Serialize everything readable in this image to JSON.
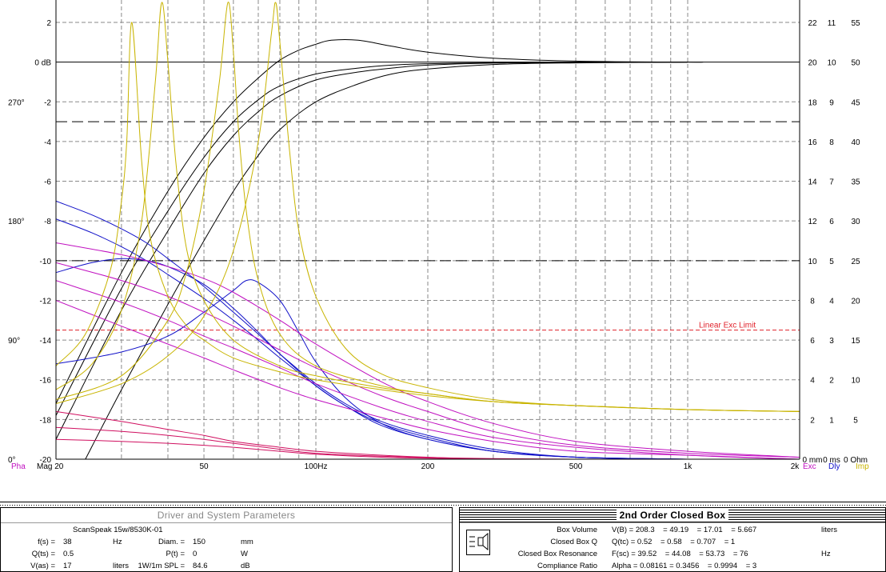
{
  "chart_data": {
    "type": "line",
    "x_scale": "log",
    "xlim": [
      20,
      2000
    ],
    "x_ticks": [
      {
        "v": 20,
        "t": "Mag 20"
      },
      {
        "v": 50,
        "t": "50"
      },
      {
        "v": 100,
        "t": "100Hz"
      },
      {
        "v": 200,
        "t": "200"
      },
      {
        "v": 500,
        "t": "500"
      },
      {
        "v": 1000,
        "t": "1k"
      },
      {
        "v": 2000,
        "t": "2k"
      }
    ],
    "mag_axis": {
      "label": "dB",
      "ylim": [
        -20,
        3
      ],
      "ticks": [
        {
          "v": 2,
          "t": "2"
        },
        {
          "v": 0,
          "t": "0 dB"
        },
        {
          "v": -2,
          "t": "-2"
        },
        {
          "v": -4,
          "t": "-4"
        },
        {
          "v": -6,
          "t": "-6"
        },
        {
          "v": -8,
          "t": "-8"
        },
        {
          "v": -10,
          "t": "-10"
        },
        {
          "v": -12,
          "t": "-12"
        },
        {
          "v": -14,
          "t": "-14"
        },
        {
          "v": -16,
          "t": "-16"
        },
        {
          "v": -18,
          "t": "-18"
        },
        {
          "v": -20,
          "t": "-20"
        }
      ]
    },
    "phase_axis": {
      "label": "Pha",
      "ticks": [
        {
          "v": -2,
          "t": "270°"
        },
        {
          "v": -8,
          "t": "180°"
        },
        {
          "v": -14,
          "t": "90°"
        },
        {
          "v": -20,
          "t": "0°"
        }
      ]
    },
    "exc_axis": {
      "label": "Exc",
      "ticks": [
        "22",
        "20",
        "18",
        "16",
        "14",
        "12",
        "10",
        "8",
        "6",
        "4",
        "2",
        "0 mm"
      ]
    },
    "dly_axis": {
      "label": "Dly",
      "ticks": [
        "11",
        "10",
        "9",
        "8",
        "7",
        "6",
        "5",
        "4",
        "3",
        "2",
        "1",
        "0 ms"
      ]
    },
    "imp_axis": {
      "label": "Imp",
      "ticks": [
        "55",
        "50",
        "45",
        "40",
        "35",
        "30",
        "25",
        "20",
        "15",
        "10",
        "5",
        "0 Ohm"
      ]
    },
    "reference_lines": [
      {
        "y": 0,
        "style": "solid"
      },
      {
        "y": -3,
        "style": "dashed"
      },
      {
        "y": -10,
        "style": "dashed"
      }
    ],
    "limit_line": {
      "y": -13.5,
      "label": "Linear Exc Limit",
      "color": "#e0202a"
    },
    "colors": {
      "magnitude": "#000000",
      "excursion": "#1010c8",
      "delay": "#c010c0",
      "impedance": "#c8b400",
      "phase": "#d01060",
      "grid": "#8a8a8a",
      "limit": "#e0202a"
    },
    "series": [
      {
        "group": "magnitude",
        "x": [
          20,
          30,
          40,
          50,
          60,
          70,
          80,
          90,
          100,
          110,
          130,
          160,
          200,
          300,
          500,
          1000,
          1100
        ],
        "y": [
          -17.2,
          -10.6,
          -6.5,
          -3.8,
          -2.0,
          -0.8,
          0.1,
          0.6,
          0.9,
          1.1,
          1.1,
          0.8,
          0.5,
          0.2,
          0.05,
          0.0,
          0.0
        ]
      },
      {
        "group": "magnitude",
        "x": [
          20,
          30,
          40,
          50,
          60,
          70,
          80,
          100,
          130,
          160,
          200,
          300,
          500,
          1000
        ],
        "y": [
          -17.8,
          -11.4,
          -7.5,
          -4.8,
          -3.0,
          -1.9,
          -1.2,
          -0.6,
          -0.3,
          -0.15,
          -0.08,
          -0.03,
          -0.01,
          0.0
        ]
      },
      {
        "group": "magnitude",
        "x": [
          20,
          30,
          40,
          50,
          60,
          70,
          80,
          100,
          130,
          160,
          200,
          300,
          500,
          1000
        ],
        "y": [
          -19.0,
          -12.5,
          -8.5,
          -5.6,
          -3.7,
          -2.5,
          -1.7,
          -0.9,
          -0.5,
          -0.3,
          -0.15,
          -0.05,
          -0.02,
          0.0
        ]
      },
      {
        "group": "magnitude",
        "x": [
          24,
          30,
          40,
          50,
          60,
          70,
          80,
          100,
          130,
          160,
          200,
          300,
          500,
          1000
        ],
        "y": [
          -20,
          -16.5,
          -12.2,
          -9.0,
          -6.5,
          -4.7,
          -3.4,
          -2.0,
          -1.1,
          -0.6,
          -0.35,
          -0.12,
          -0.04,
          0.0
        ]
      },
      {
        "group": "excursion",
        "x": [
          20,
          25,
          30,
          35,
          40,
          50,
          60,
          70,
          80,
          100,
          120,
          150,
          200,
          300,
          500,
          1000
        ],
        "y": [
          -10.6,
          -10.1,
          -9.9,
          -10.0,
          -10.3,
          -11.2,
          -12.4,
          -13.6,
          -14.7,
          -16.3,
          -17.3,
          -18.3,
          -19.0,
          -19.6,
          -19.9,
          -20.0
        ]
      },
      {
        "group": "excursion",
        "x": [
          20,
          25,
          30,
          35,
          40,
          50,
          60,
          70,
          80,
          100,
          120,
          150,
          200,
          300,
          500,
          1000
        ],
        "y": [
          -7.9,
          -8.6,
          -9.3,
          -10.0,
          -10.7,
          -11.9,
          -13.0,
          -14.0,
          -14.9,
          -16.3,
          -17.3,
          -18.2,
          -18.9,
          -19.6,
          -19.9,
          -20.0
        ]
      },
      {
        "group": "excursion",
        "x": [
          20,
          25,
          30,
          35,
          40,
          50,
          60,
          70,
          80,
          100,
          120,
          150,
          200,
          300,
          500,
          1000
        ],
        "y": [
          -7.0,
          -7.7,
          -8.4,
          -9.1,
          -9.9,
          -11.3,
          -12.6,
          -13.7,
          -14.7,
          -16.2,
          -17.2,
          -18.1,
          -18.8,
          -19.5,
          -19.9,
          -20.0
        ]
      },
      {
        "group": "excursion",
        "x": [
          20,
          30,
          40,
          50,
          60,
          65,
          70,
          80,
          90,
          100,
          120,
          150,
          200,
          300,
          500,
          1000
        ],
        "y": [
          -15.2,
          -14.6,
          -13.8,
          -12.6,
          -11.5,
          -11.0,
          -11.1,
          -12.0,
          -13.6,
          -15.1,
          -16.9,
          -18.2,
          -19.0,
          -19.6,
          -19.9,
          -20.0
        ]
      },
      {
        "group": "delay",
        "x": [
          20,
          30,
          40,
          50,
          60,
          80,
          100,
          150,
          200,
          300,
          500,
          1000,
          2000
        ],
        "y": [
          -9.1,
          -9.7,
          -10.3,
          -10.9,
          -11.6,
          -13.0,
          -14.2,
          -16.1,
          -17.1,
          -18.2,
          -19.1,
          -19.6,
          -19.9
        ]
      },
      {
        "group": "delay",
        "x": [
          20,
          30,
          40,
          50,
          60,
          80,
          100,
          150,
          200,
          300,
          500,
          1000,
          2000
        ],
        "y": [
          -10.1,
          -11.0,
          -11.8,
          -12.6,
          -13.3,
          -14.5,
          -15.4,
          -16.8,
          -17.6,
          -18.6,
          -19.3,
          -19.7,
          -19.9
        ]
      },
      {
        "group": "delay",
        "x": [
          20,
          30,
          40,
          50,
          60,
          80,
          100,
          150,
          200,
          300,
          500,
          1000,
          2000
        ],
        "y": [
          -11.0,
          -12.1,
          -13.0,
          -13.8,
          -14.4,
          -15.4,
          -16.2,
          -17.4,
          -18.1,
          -18.9,
          -19.4,
          -19.8,
          -20.0
        ]
      },
      {
        "group": "delay",
        "x": [
          20,
          30,
          40,
          50,
          60,
          80,
          100,
          150,
          200,
          300,
          500,
          1000,
          2000
        ],
        "y": [
          -12.0,
          -13.3,
          -14.2,
          -14.9,
          -15.5,
          -16.4,
          -17.0,
          -17.9,
          -18.5,
          -19.1,
          -19.6,
          -19.8,
          -20.0
        ]
      },
      {
        "group": "phase",
        "x": [
          20,
          30,
          40,
          50,
          60,
          80,
          100,
          150,
          200,
          300,
          500,
          1000,
          2000
        ],
        "y": [
          -17.6,
          -18.1,
          -18.5,
          -18.8,
          -19.1,
          -19.4,
          -19.6,
          -19.8,
          -19.9,
          -20.0,
          -20.0,
          -20.0,
          -20.0
        ]
      },
      {
        "group": "phase",
        "x": [
          20,
          30,
          40,
          50,
          60,
          80,
          100,
          150,
          200,
          300,
          500,
          1000,
          2000
        ],
        "y": [
          -18.4,
          -18.6,
          -18.8,
          -19.0,
          -19.2,
          -19.5,
          -19.7,
          -19.85,
          -19.92,
          -19.97,
          -20.0,
          -20.0,
          -20.0
        ]
      },
      {
        "group": "phase",
        "x": [
          20,
          30,
          40,
          50,
          60,
          80,
          100,
          150,
          200,
          300,
          500,
          1000,
          2000
        ],
        "y": [
          -19.0,
          -19.1,
          -19.2,
          -19.3,
          -19.4,
          -19.6,
          -19.75,
          -19.9,
          -19.95,
          -20.0,
          -20.0,
          -20.0,
          -20.0
        ]
      },
      {
        "group": "impedance",
        "x": [
          20,
          24,
          28,
          30,
          31,
          32,
          34,
          36,
          40,
          45,
          50,
          60,
          80,
          100,
          150,
          200,
          300,
          500,
          1000,
          2000
        ],
        "y": [
          -15.3,
          -13.7,
          -10.5,
          -7.0,
          -4.0,
          2.0,
          -5.0,
          -9.0,
          -11.8,
          -13.3,
          -14.0,
          -14.9,
          -15.6,
          -16.0,
          -16.5,
          -16.8,
          -17.1,
          -17.3,
          -17.5,
          -17.6
        ]
      },
      {
        "group": "impedance",
        "x": [
          20,
          25,
          30,
          34,
          37,
          38.5,
          40,
          42,
          45,
          50,
          60,
          80,
          100,
          150,
          200,
          300,
          500,
          1000,
          2000
        ],
        "y": [
          -16.5,
          -15.2,
          -12.5,
          -8.0,
          -1.0,
          3.0,
          0.0,
          -5.0,
          -9.5,
          -12.0,
          -14.0,
          -15.3,
          -15.8,
          -16.4,
          -16.7,
          -17.1,
          -17.3,
          -17.5,
          -17.6
        ]
      },
      {
        "group": "impedance",
        "x": [
          20,
          30,
          40,
          45,
          50,
          55,
          58,
          60,
          62,
          65,
          70,
          80,
          100,
          150,
          200,
          300,
          500,
          1000,
          2000
        ],
        "y": [
          -17.0,
          -15.8,
          -13.0,
          -10.5,
          -6.5,
          -1.0,
          3.0,
          0.5,
          -3.5,
          -7.5,
          -11.0,
          -13.7,
          -15.3,
          -16.3,
          -16.7,
          -17.1,
          -17.3,
          -17.5,
          -17.6
        ]
      },
      {
        "group": "impedance",
        "x": [
          20,
          30,
          40,
          50,
          60,
          70,
          76,
          78,
          80,
          85,
          90,
          100,
          120,
          150,
          200,
          300,
          500,
          1000,
          2000
        ],
        "y": [
          -17.2,
          -16.2,
          -14.8,
          -12.8,
          -9.5,
          -4.0,
          1.5,
          3.0,
          1.0,
          -4.5,
          -8.5,
          -11.8,
          -14.4,
          -15.7,
          -16.4,
          -17.0,
          -17.3,
          -17.5,
          -17.6
        ]
      }
    ]
  },
  "driver_panel": {
    "title": "Driver and System Parameters",
    "driver_name": "ScanSpeak 15w/8530K-01",
    "rows": [
      {
        "l1": "f(s) =",
        "v1": "38",
        "u1": "Hz",
        "l2": "Diam. =",
        "v2": "150",
        "u2": "mm"
      },
      {
        "l1": "Q(ts) =",
        "v1": "0.5",
        "u1": "",
        "l2": "P(t) =",
        "v2": "0",
        "u2": "W"
      },
      {
        "l1": "V(as) =",
        "v1": "17",
        "u1": "liters",
        "l2": "1W/1m SPL =",
        "v2": "84.6",
        "u2": "dB"
      }
    ]
  },
  "box_panel": {
    "title": "2nd Order Closed Box",
    "rows": [
      {
        "label": "Box Volume",
        "expr": "V(B) = 208.3    = 49.19    = 17.01    = 5.667",
        "unit": "liters"
      },
      {
        "label": "Closed Box Q",
        "expr": "Q(tc) = 0.52    = 0.58    = 0.707    = 1",
        "unit": ""
      },
      {
        "label": "Closed Box Resonance",
        "expr": "F(sc) = 39.52    = 44.08    = 53.73    = 76",
        "unit": "Hz"
      },
      {
        "label": "Compliance Ratio",
        "expr": "Alpha = 0.08161 = 0.3456    = 0.9994    = 3",
        "unit": ""
      }
    ]
  }
}
